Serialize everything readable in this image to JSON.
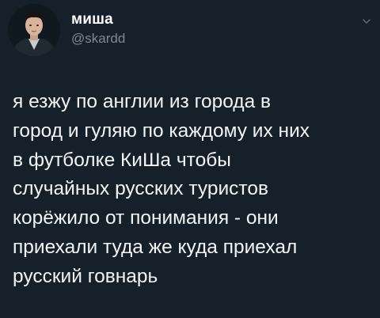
{
  "tweet": {
    "author": {
      "display_name": "миша",
      "handle": "@skardd",
      "avatar_icon": "profile-photo"
    },
    "menu_icon": "chevron-down-icon",
    "text_lines": [
      "я езжу по англии из города в",
      "город и гуляю по каждому их них",
      "в футболке КиШа чтобы",
      "случайных русских туристов",
      "корёжило от понимания - они",
      "приехали туда же куда приехал",
      "русский говнарь"
    ]
  },
  "colors": {
    "background": "#15202b",
    "text_primary": "#f2f4f5",
    "text_secondary": "#7c8a97"
  }
}
